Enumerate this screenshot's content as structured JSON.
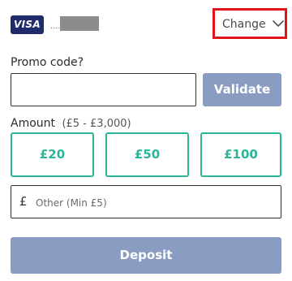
{
  "payment_method": {
    "card_brand": "VISA",
    "masked_prefix": "....",
    "change_label": "Change",
    "change_icon": "chevron-down-icon",
    "highlight_color": "#e0141b"
  },
  "promo": {
    "label": "Promo code?",
    "value": "",
    "placeholder": "",
    "validate_label": "Validate"
  },
  "amount": {
    "label": "Amount",
    "range": "(£5  -  £3,000)",
    "options": [
      "£20",
      "£50",
      "£100"
    ],
    "other_currency": "£",
    "other_placeholder": "Other (Min £5)"
  },
  "deposit_label": "Deposit",
  "colors": {
    "accent_green": "#2bb596",
    "button_disabled": "#8a9cc2",
    "visa_blue": "#1f2b6b"
  }
}
